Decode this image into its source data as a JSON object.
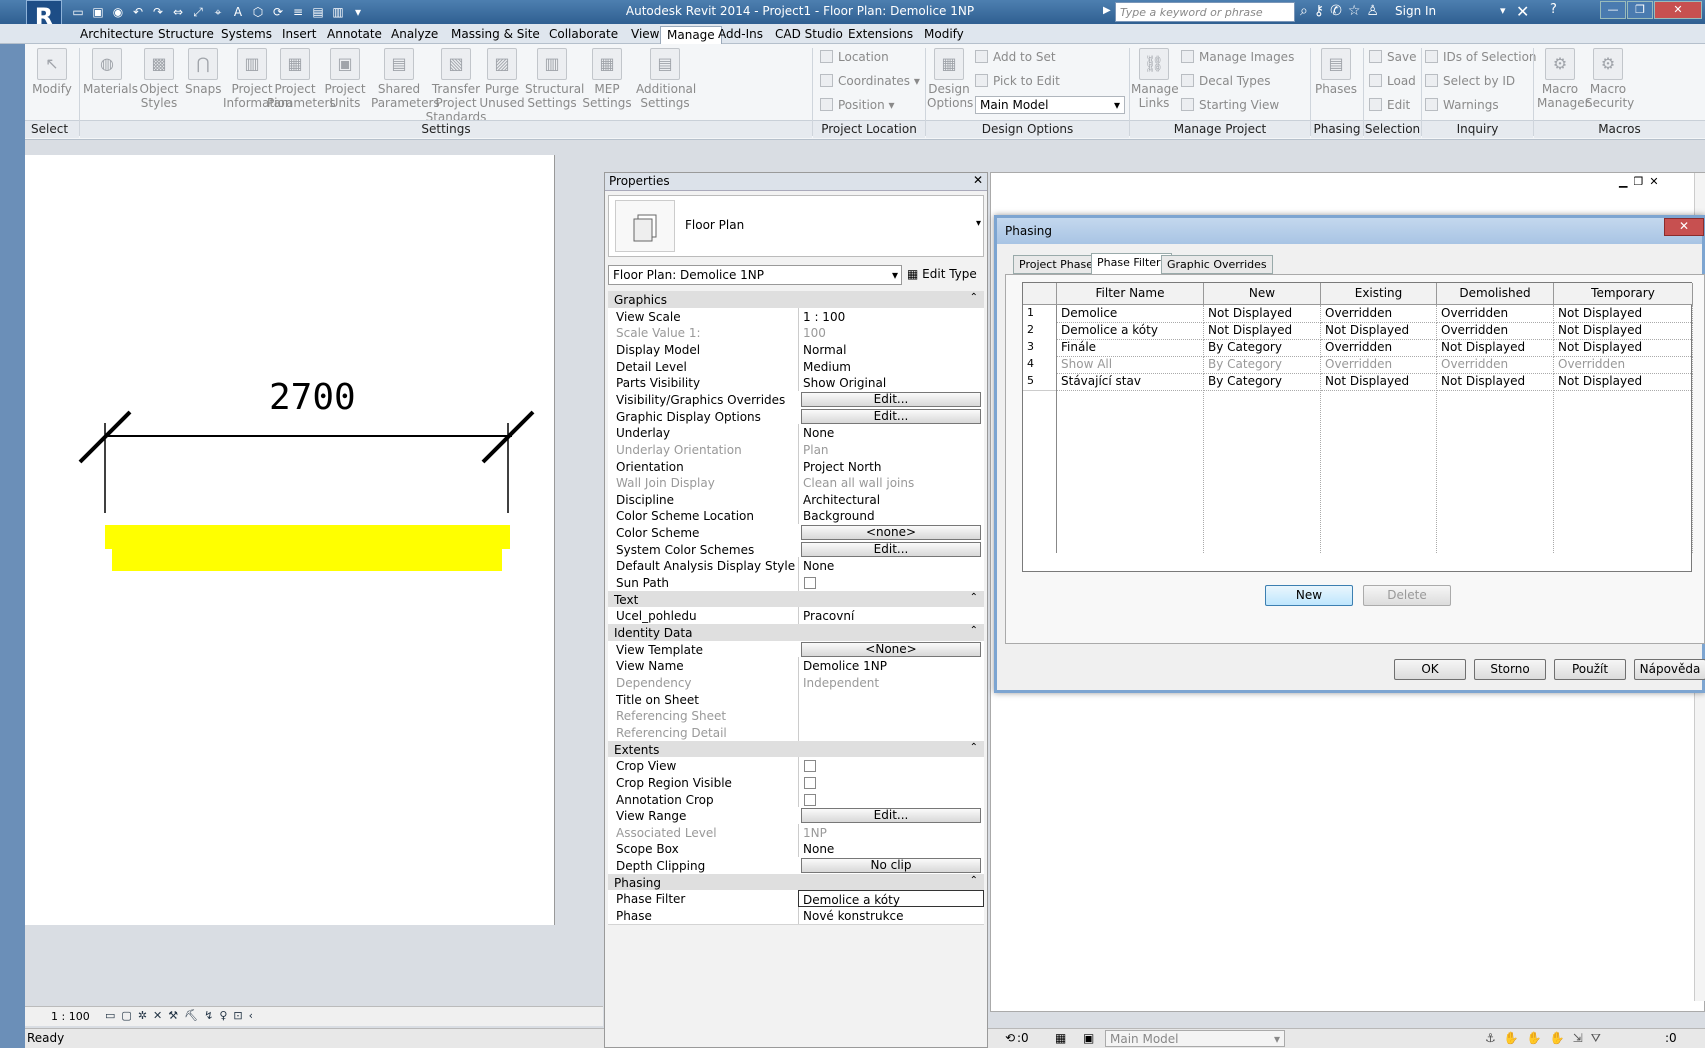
{
  "app": {
    "logo": "R",
    "title": "Autodesk Revit 2014 -     Project1 - Floor Plan: Demolice 1NP",
    "search_placeholder": "Type a keyword or phrase",
    "sign_in": "Sign In"
  },
  "tabs": [
    "Architecture",
    "Structure",
    "Systems",
    "Insert",
    "Annotate",
    "Analyze",
    "Massing & Site",
    "Collaborate",
    "View",
    "Manage",
    "Add-Ins",
    "CAD Studio",
    "Extensions",
    "Modify"
  ],
  "active_tab": "Manage",
  "ribbon": {
    "modify": "Modify",
    "select": "Select",
    "settings_buttons": [
      "Materials",
      "Object Styles",
      "Snaps",
      "Project Information",
      "Project Parameters",
      "Project Units",
      "Shared Parameters",
      "Transfer Project Standards",
      "Purge Unused",
      "Structural Settings",
      "MEP Settings",
      "Additional Settings"
    ],
    "location_items": [
      "Location",
      "Coordinates",
      "Position"
    ],
    "design_options_btn": "Design Options",
    "design_options_items": [
      "Add to Set",
      "Pick to Edit"
    ],
    "main_model": "Main Model",
    "manage_links": "Manage Links",
    "manage_project_items": [
      "Manage Images",
      "Decal Types",
      "Starting View"
    ],
    "phases": "Phases",
    "selection_items": [
      "Save",
      "Load",
      "Edit"
    ],
    "inquiry_items": [
      "IDs of Selection",
      "Select by ID",
      "Warnings"
    ],
    "macro_manager": "Macro Manager",
    "macro_security": "Macro Security",
    "panels": [
      "Select",
      "Settings",
      "Project Location",
      "Design Options",
      "Manage Project",
      "Phasing",
      "Selection",
      "Inquiry",
      "Macros"
    ]
  },
  "canvas": {
    "dimension": "2700",
    "scale": "1 : 100",
    "highlight_color": "#ffff00"
  },
  "status": {
    "ready": "Ready",
    "main_model": "Main Model",
    "count_left": ":0",
    "count_right": ":0"
  },
  "properties": {
    "title": "Properties",
    "type_name": "Floor Plan",
    "view_selector": "Floor Plan: Demolice 1NP",
    "edit_type": "Edit Type",
    "groups": {
      "graphics": "Graphics",
      "text": "Text",
      "identity": "Identity Data",
      "extents": "Extents",
      "phasing": "Phasing"
    },
    "rows": {
      "view_scale": [
        "View Scale",
        "1 : 100"
      ],
      "scale_value": [
        "Scale Value    1:",
        "100"
      ],
      "display_model": [
        "Display Model",
        "Normal"
      ],
      "detail_level": [
        "Detail Level",
        "Medium"
      ],
      "parts_visibility": [
        "Parts Visibility",
        "Show Original"
      ],
      "vg_overrides": [
        "Visibility/Graphics Overrides",
        "Edit..."
      ],
      "graphic_display": [
        "Graphic Display Options",
        "Edit..."
      ],
      "underlay": [
        "Underlay",
        "None"
      ],
      "underlay_orientation": [
        "Underlay Orientation",
        "Plan"
      ],
      "orientation": [
        "Orientation",
        "Project North"
      ],
      "wall_join": [
        "Wall Join Display",
        "Clean all wall joins"
      ],
      "discipline": [
        "Discipline",
        "Architectural"
      ],
      "color_scheme_location": [
        "Color Scheme Location",
        "Background"
      ],
      "color_scheme": [
        "Color Scheme",
        "<none>"
      ],
      "system_color": [
        "System Color Schemes",
        "Edit..."
      ],
      "default_analysis": [
        "Default Analysis Display Style",
        "None"
      ],
      "sun_path": [
        "Sun Path",
        ""
      ],
      "ucel": [
        "Ucel_pohledu",
        "Pracovní"
      ],
      "view_template": [
        "View Template",
        "<None>"
      ],
      "view_name": [
        "View Name",
        "Demolice 1NP"
      ],
      "dependency": [
        "Dependency",
        "Independent"
      ],
      "title_on_sheet": [
        "Title on Sheet",
        ""
      ],
      "ref_sheet": [
        "Referencing Sheet",
        ""
      ],
      "ref_detail": [
        "Referencing Detail",
        ""
      ],
      "crop_view": [
        "Crop View",
        ""
      ],
      "crop_region": [
        "Crop Region Visible",
        ""
      ],
      "annotation_crop": [
        "Annotation Crop",
        ""
      ],
      "view_range": [
        "View Range",
        "Edit..."
      ],
      "associated_level": [
        "Associated Level",
        "1NP"
      ],
      "scope_box": [
        "Scope Box",
        "None"
      ],
      "depth_clipping": [
        "Depth Clipping",
        "No clip"
      ],
      "phase_filter": [
        "Phase Filter",
        "Demolice a kóty"
      ],
      "phase": [
        "Phase",
        "Nové konstrukce"
      ]
    }
  },
  "dialog": {
    "title": "Phasing",
    "close": "✕",
    "tabs": [
      "Project Phases",
      "Phase Filters",
      "Graphic Overrides"
    ],
    "active_tab": "Phase Filters",
    "columns": [
      "Filter Name",
      "New",
      "Existing",
      "Demolished",
      "Temporary"
    ],
    "rows": [
      {
        "n": "1",
        "name": "Demolice",
        "new": "Not Displayed",
        "existing": "Overridden",
        "demolished": "Overridden",
        "temporary": "Not Displayed",
        "dim": false
      },
      {
        "n": "2",
        "name": "Demolice a kóty",
        "new": "Not Displayed",
        "existing": "Not Displayed",
        "demolished": "Overridden",
        "temporary": "Not Displayed",
        "dim": false
      },
      {
        "n": "3",
        "name": "Finále",
        "new": "By Category",
        "existing": "Overridden",
        "demolished": "Not Displayed",
        "temporary": "Not Displayed",
        "dim": false
      },
      {
        "n": "4",
        "name": "Show All",
        "new": "By Category",
        "existing": "Overridden",
        "demolished": "Overridden",
        "temporary": "Overridden",
        "dim": true
      },
      {
        "n": "5",
        "name": "Stávající stav",
        "new": "By Category",
        "existing": "Not Displayed",
        "demolished": "Not Displayed",
        "temporary": "Not Displayed",
        "dim": false
      }
    ],
    "new_btn": "New",
    "delete_btn": "Delete",
    "ok_btn": "OK",
    "cancel_btn": "Storno",
    "apply_btn": "Použít",
    "help_btn": "Nápověda"
  }
}
